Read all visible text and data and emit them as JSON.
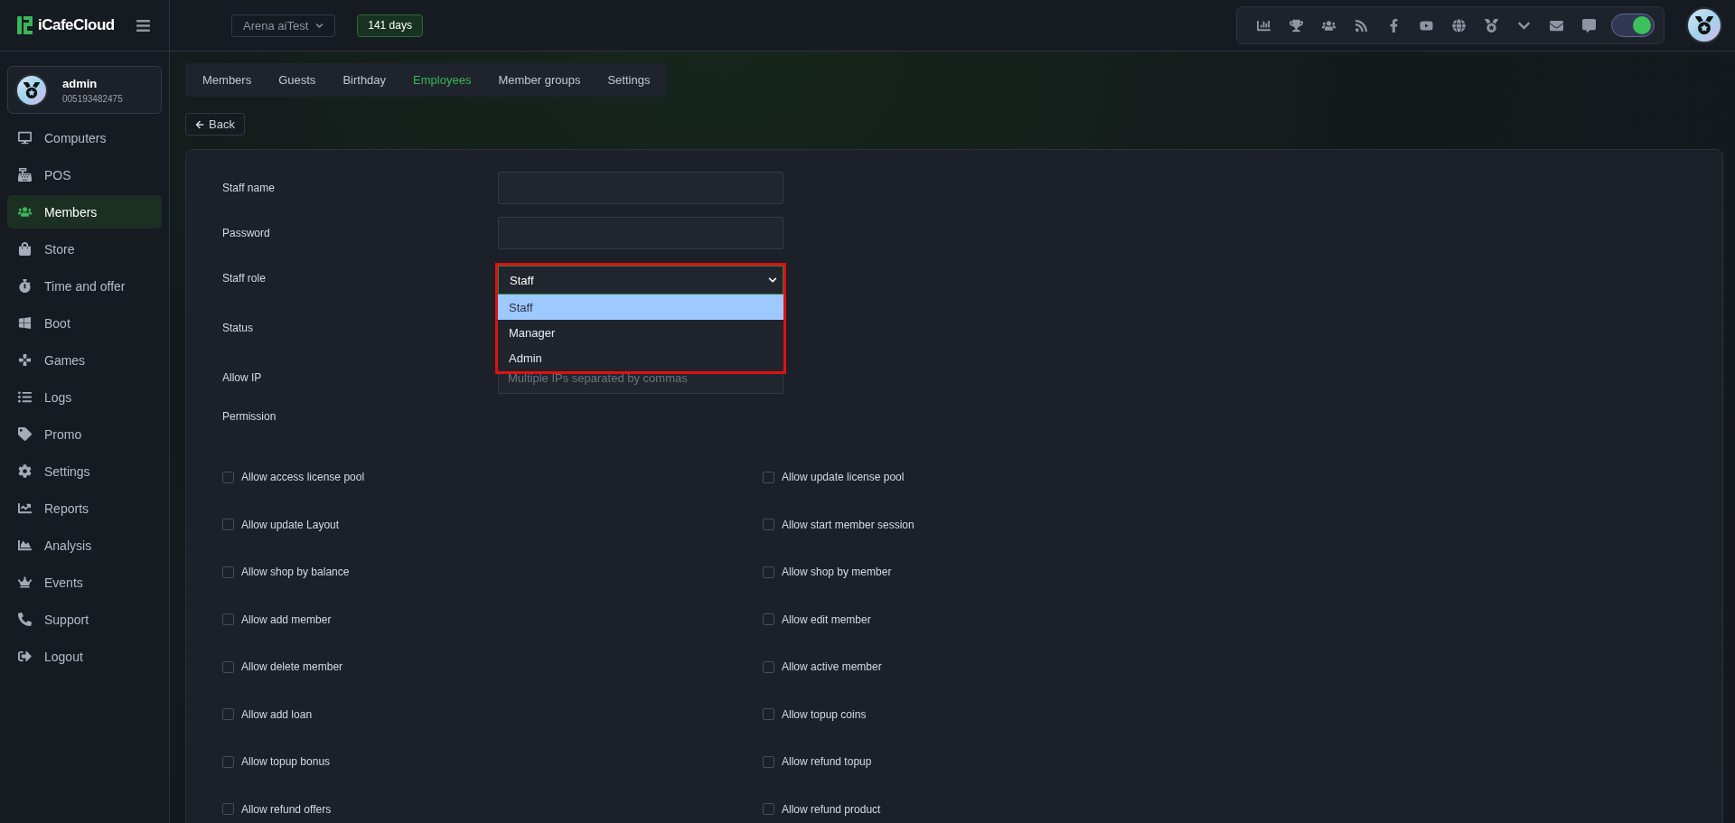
{
  "topbar": {
    "brand": "iCafeCloud",
    "cafe_selector": "Arena aiTest",
    "license_badge": "141 days",
    "dark_mode_on": true
  },
  "user": {
    "name": "admin",
    "id": "005193482475"
  },
  "sidebar": {
    "items": [
      {
        "label": "Computers",
        "selected": false
      },
      {
        "label": "POS",
        "selected": false
      },
      {
        "label": "Members",
        "selected": true
      },
      {
        "label": "Store",
        "selected": false
      },
      {
        "label": "Time and offer",
        "selected": false
      },
      {
        "label": "Boot",
        "selected": false
      },
      {
        "label": "Games",
        "selected": false
      },
      {
        "label": "Logs",
        "selected": false
      },
      {
        "label": "Promo",
        "selected": false
      },
      {
        "label": "Settings",
        "selected": false
      },
      {
        "label": "Reports",
        "selected": false
      },
      {
        "label": "Analysis",
        "selected": false
      },
      {
        "label": "Events",
        "selected": false
      },
      {
        "label": "Support",
        "selected": false
      },
      {
        "label": "Logout",
        "selected": false
      }
    ]
  },
  "tabs": [
    {
      "label": "Members",
      "selected": false
    },
    {
      "label": "Guests",
      "selected": false
    },
    {
      "label": "Birthday",
      "selected": false
    },
    {
      "label": "Employees",
      "selected": true
    },
    {
      "label": "Member groups",
      "selected": false
    },
    {
      "label": "Settings",
      "selected": false
    }
  ],
  "back_button": "Back",
  "form": {
    "fields": [
      {
        "kind": "text",
        "label": "Staff name"
      },
      {
        "kind": "password",
        "label": "Password"
      },
      {
        "kind": "select",
        "label": "Staff role",
        "value": "Staff",
        "expanded": true,
        "options": [
          {
            "label": "Staff",
            "selected": true
          },
          {
            "label": "Manager",
            "selected": false
          },
          {
            "label": "Admin",
            "selected": false
          }
        ]
      },
      {
        "kind": "blank",
        "label": "Status"
      },
      {
        "kind": "text",
        "label": "Allow IP",
        "placeholder": "Multiple IPs separated by commas"
      }
    ],
    "permission_heading": "Permission",
    "permissions": [
      {
        "label": "Allow access license pool",
        "checked": false
      },
      {
        "label": "Allow update license pool",
        "checked": false
      },
      {
        "label": "Allow update Layout",
        "checked": false
      },
      {
        "label": "Allow start member session",
        "checked": false
      },
      {
        "label": "Allow shop by balance",
        "checked": false
      },
      {
        "label": "Allow shop by member",
        "checked": false
      },
      {
        "label": "Allow add member",
        "checked": false
      },
      {
        "label": "Allow edit member",
        "checked": false
      },
      {
        "label": "Allow delete member",
        "checked": false
      },
      {
        "label": "Allow active member",
        "checked": false
      },
      {
        "label": "Allow add loan",
        "checked": false
      },
      {
        "label": "Allow topup coins",
        "checked": false
      },
      {
        "label": "Allow topup bonus",
        "checked": false
      },
      {
        "label": "Allow refund topup",
        "checked": false
      },
      {
        "label": "Allow refund offers",
        "checked": false
      },
      {
        "label": "Allow refund product",
        "checked": false
      }
    ]
  }
}
